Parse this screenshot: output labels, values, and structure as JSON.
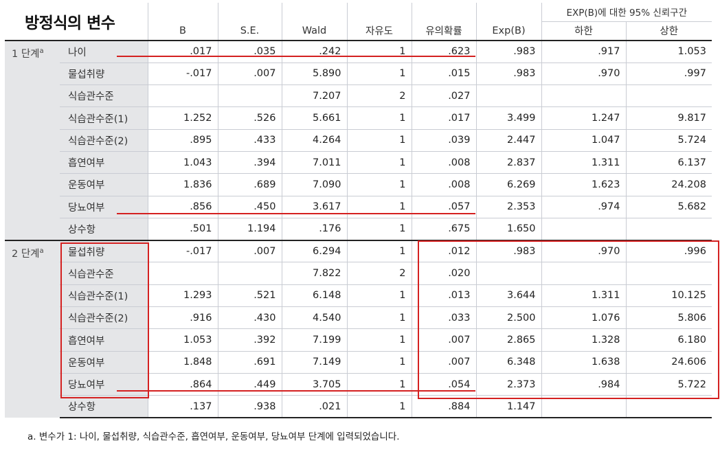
{
  "title": "방정식의 변수",
  "headers": {
    "b": "B",
    "se": "S.E.",
    "wald": "Wald",
    "df": "자유도",
    "sig": "유의확률",
    "expb": "Exp(B)",
    "ci_group": "EXP(B)에 대한 95% 신뢰구간",
    "lower": "하한",
    "upper": "상한"
  },
  "steps": [
    {
      "label": "1 단계",
      "sup": "a",
      "rows": [
        {
          "var": "나이",
          "b": ".017",
          "se": ".035",
          "wald": ".242",
          "df": "1",
          "sig": ".623",
          "expb": ".983",
          "lower": ".917",
          "upper": "1.053"
        },
        {
          "var": "물섭취량",
          "b": "-.017",
          "se": ".007",
          "wald": "5.890",
          "df": "1",
          "sig": ".015",
          "expb": ".983",
          "lower": ".970",
          "upper": ".997"
        },
        {
          "var": "식습관수준",
          "b": "",
          "se": "",
          "wald": "7.207",
          "df": "2",
          "sig": ".027",
          "expb": "",
          "lower": "",
          "upper": ""
        },
        {
          "var": "식습관수준(1)",
          "b": "1.252",
          "se": ".526",
          "wald": "5.661",
          "df": "1",
          "sig": ".017",
          "expb": "3.499",
          "lower": "1.247",
          "upper": "9.817"
        },
        {
          "var": "식습관수준(2)",
          "b": ".895",
          "se": ".433",
          "wald": "4.264",
          "df": "1",
          "sig": ".039",
          "expb": "2.447",
          "lower": "1.047",
          "upper": "5.724"
        },
        {
          "var": "흡연여부",
          "b": "1.043",
          "se": ".394",
          "wald": "7.011",
          "df": "1",
          "sig": ".008",
          "expb": "2.837",
          "lower": "1.311",
          "upper": "6.137"
        },
        {
          "var": "운동여부",
          "b": "1.836",
          "se": ".689",
          "wald": "7.090",
          "df": "1",
          "sig": ".008",
          "expb": "6.269",
          "lower": "1.623",
          "upper": "24.208"
        },
        {
          "var": "당뇨여부",
          "b": ".856",
          "se": ".450",
          "wald": "3.617",
          "df": "1",
          "sig": ".057",
          "expb": "2.353",
          "lower": ".974",
          "upper": "5.682"
        },
        {
          "var": "상수항",
          "b": ".501",
          "se": "1.194",
          "wald": ".176",
          "df": "1",
          "sig": ".675",
          "expb": "1.650",
          "lower": "",
          "upper": ""
        }
      ]
    },
    {
      "label": "2 단계",
      "sup": "a",
      "rows": [
        {
          "var": "물섭취량",
          "b": "-.017",
          "se": ".007",
          "wald": "6.294",
          "df": "1",
          "sig": ".012",
          "expb": ".983",
          "lower": ".970",
          "upper": ".996"
        },
        {
          "var": "식습관수준",
          "b": "",
          "se": "",
          "wald": "7.822",
          "df": "2",
          "sig": ".020",
          "expb": "",
          "lower": "",
          "upper": ""
        },
        {
          "var": "식습관수준(1)",
          "b": "1.293",
          "se": ".521",
          "wald": "6.148",
          "df": "1",
          "sig": ".013",
          "expb": "3.644",
          "lower": "1.311",
          "upper": "10.125"
        },
        {
          "var": "식습관수준(2)",
          "b": ".916",
          "se": ".430",
          "wald": "4.540",
          "df": "1",
          "sig": ".033",
          "expb": "2.500",
          "lower": "1.076",
          "upper": "5.806"
        },
        {
          "var": "흡연여부",
          "b": "1.053",
          "se": ".392",
          "wald": "7.199",
          "df": "1",
          "sig": ".007",
          "expb": "2.865",
          "lower": "1.328",
          "upper": "6.180"
        },
        {
          "var": "운동여부",
          "b": "1.848",
          "se": ".691",
          "wald": "7.149",
          "df": "1",
          "sig": ".007",
          "expb": "6.348",
          "lower": "1.638",
          "upper": "24.606"
        },
        {
          "var": "당뇨여부",
          "b": ".864",
          "se": ".449",
          "wald": "3.705",
          "df": "1",
          "sig": ".054",
          "expb": "2.373",
          "lower": ".984",
          "upper": "5.722"
        },
        {
          "var": "상수항",
          "b": ".137",
          "se": ".938",
          "wald": ".021",
          "df": "1",
          "sig": ".884",
          "expb": "1.147",
          "lower": "",
          "upper": ""
        }
      ]
    }
  ],
  "footnote": "a. 변수가 1: 나이, 물섭취량, 식습관수준, 흡연여부, 운동여부, 당뇨여부 단계에 입력되었습니다.",
  "annotation_color": "#d42020"
}
